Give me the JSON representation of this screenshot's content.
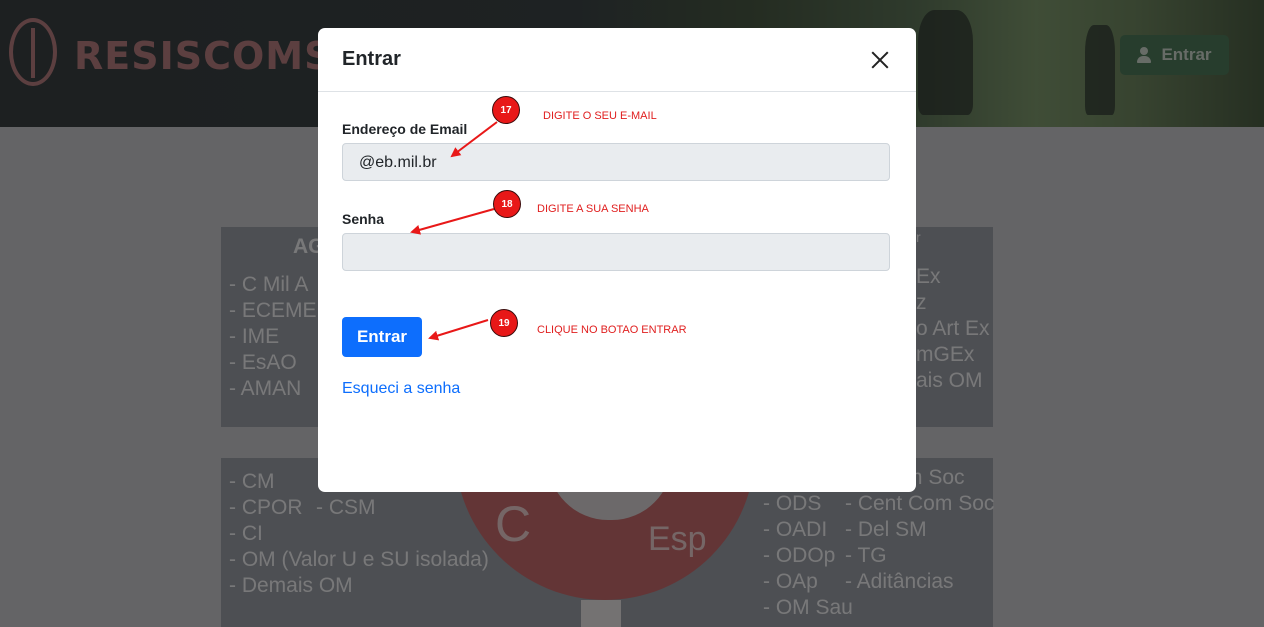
{
  "background": {
    "brand": "RESISCOMSE",
    "login_button": "Entrar",
    "panel_left_title": "AG",
    "panel_left_items": [
      "- C Mil A",
      "- ECEME",
      "- IME",
      "- EsAO",
      "- AMAN"
    ],
    "panel_right_top_items": [
      "r",
      "Ex",
      "z",
      "o Art Ex",
      "mGEx",
      "ais OM"
    ],
    "panel_bottom_left_items": [
      "- CM",
      "- CPOR",
      "- CSM",
      "- CI",
      "- OM (Valor U e SU isolada)",
      "- Demais OM"
    ],
    "panel_bottom_right_col1": [
      "- ODS",
      "- OADI",
      "- ODOp",
      "- OAp",
      "- OM Sau"
    ],
    "panel_bottom_right_col2": [
      "m Soc",
      "- Cent Com Soc",
      "- Del SM",
      "- TG",
      "- Aditâncias"
    ],
    "circle_letter_left": "C",
    "circle_letter_right": "Esp"
  },
  "modal": {
    "title": "Entrar",
    "email_label": "Endereço de Email",
    "email_value": "@eb.mil.br",
    "password_label": "Senha",
    "password_value": "",
    "submit_label": "Entrar",
    "forgot_label": "Esqueci a senha"
  },
  "annotations": [
    {
      "number": "17",
      "text": "DIGITE O SEU E-MAIL"
    },
    {
      "number": "18",
      "text": "DIGITE A SUA SENHA"
    },
    {
      "number": "19",
      "text": "CLIQUE NO BOTAO ENTRAR"
    }
  ],
  "colors": {
    "primary": "#0d6efd",
    "annotation_red": "#e81818",
    "overlay": "rgba(0,0,0,0.5)"
  }
}
